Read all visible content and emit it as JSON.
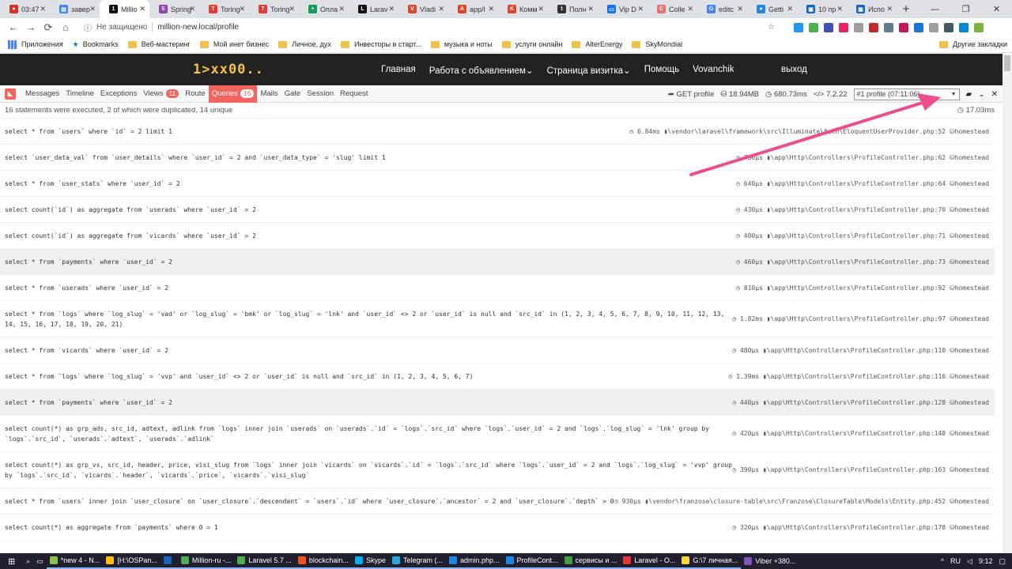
{
  "browser": {
    "tabs": [
      {
        "label": "03:47",
        "color": "#d93025",
        "glyph": "●"
      },
      {
        "label": "завер",
        "color": "#4285f4",
        "glyph": "▤"
      },
      {
        "label": "Millio",
        "color": "#111111",
        "glyph": "1",
        "active": true
      },
      {
        "label": "Spring",
        "color": "#8e44ad",
        "glyph": "S"
      },
      {
        "label": "Toring",
        "color": "#e53935",
        "glyph": "T"
      },
      {
        "label": "Toring",
        "color": "#e53935",
        "glyph": "T"
      },
      {
        "label": "Опла",
        "color": "#0f9d58",
        "glyph": "+"
      },
      {
        "label": "Larav",
        "color": "#111111",
        "glyph": "L"
      },
      {
        "label": "Vladi",
        "color": "#e2432a",
        "glyph": "V"
      },
      {
        "label": "app/l",
        "color": "#e2432a",
        "glyph": "A"
      },
      {
        "label": "Комм",
        "color": "#e2432a",
        "glyph": "K"
      },
      {
        "label": "Полн",
        "color": "#333333",
        "glyph": "t"
      },
      {
        "label": "Vip D",
        "color": "#1a73e8",
        "glyph": "▭"
      },
      {
        "label": "Colle",
        "color": "#e57373",
        "glyph": "C"
      },
      {
        "label": "editc",
        "color": "#4285f4",
        "glyph": "G"
      },
      {
        "label": "Getti",
        "color": "#1e88e5",
        "glyph": "●"
      },
      {
        "label": "10 пр",
        "color": "#1565c0",
        "glyph": "▣"
      },
      {
        "label": "Испо",
        "color": "#1565c0",
        "glyph": "▣"
      }
    ],
    "new_tab": "+",
    "window_controls": {
      "minimize": "—",
      "maximize": "❐",
      "close": "✕"
    },
    "nav": {
      "back": "←",
      "forward": "→",
      "reload": "⟳",
      "home": "⌂"
    },
    "address": {
      "info_icon": "ⓘ",
      "security": "Не защищено",
      "url": "million-new.local/profile",
      "star": "☆"
    },
    "extension_colors": [
      "#2196f3",
      "#4caf50",
      "#3f51b5",
      "#e91e63",
      "#9e9e9e",
      "#c62828",
      "#607d8b",
      "#c2185b",
      "#1976d2",
      "#9e9e9e",
      "#455a64",
      "#0288d1",
      "#7cb342"
    ],
    "bookmarks": {
      "apps": "Приложения",
      "items": [
        "Bookmarks",
        "Веб-мастеринг",
        "Мой инет бизнес",
        "Личное, дух",
        "Инвесторы в старт...",
        "музыка и ноты",
        "услуги онлайн",
        "AlterEnergy",
        "SkyMondial"
      ],
      "other": "Другие закладки"
    }
  },
  "site": {
    "logo": "1>xx00..",
    "nav": [
      "Главная",
      "Работа с объявлением⌄",
      "Страница визитка⌄",
      "Помощь",
      "Vovanchik"
    ],
    "logout": "выход"
  },
  "debugbar": {
    "tabs": [
      {
        "label": "Messages"
      },
      {
        "label": "Timeline"
      },
      {
        "label": "Exceptions"
      },
      {
        "label": "Views",
        "badge": "11"
      },
      {
        "label": "Route"
      },
      {
        "label": "Queries",
        "badge": "16",
        "active": true
      },
      {
        "label": "Mails"
      },
      {
        "label": "Gate"
      },
      {
        "label": "Session"
      },
      {
        "label": "Request"
      }
    ],
    "request": "GET profile",
    "memory": "18.94MB",
    "time": "680.73ms",
    "php": "7.2.22",
    "profile_select": "#1 profile (07:11:06)",
    "icons": {
      "request": "➦",
      "memory": "⛁",
      "time": "◷",
      "php": "</>",
      "folder": "📂",
      "collapse": "⌄",
      "close": "✕"
    }
  },
  "summary": {
    "text": "16 statements were executed, 2 of which were duplicated, 14 unique",
    "total_time": "17.03ms"
  },
  "queries": [
    {
      "sql": "select * from `users` where `id` = 2 limit 1",
      "duration": "6.84ms",
      "source": "\\vendor\\laravel\\framework\\src\\Illuminate\\Auth\\EloquentUserProvider.php:52",
      "connection": "homestead"
    },
    {
      "sql": "select `user_data_val` from `user_details` where `user_id` = 2 and `user_data_type` = 'slug' limit 1",
      "duration": "730μs",
      "source": "\\app\\Http\\Controllers\\ProfileController.php:62",
      "connection": "homestead"
    },
    {
      "sql": "select * from `user_stats` where `user_id` = 2",
      "duration": "640μs",
      "source": "\\app\\Http\\Controllers\\ProfileController.php:64",
      "connection": "homestead"
    },
    {
      "sql": "select count(`id`) as aggregate from `userads` where `user_id` = 2",
      "duration": "430μs",
      "source": "\\app\\Http\\Controllers\\ProfileController.php:70",
      "connection": "homestead"
    },
    {
      "sql": "select count(`id`) as aggregate from `vicards` where `user_id` = 2",
      "duration": "400μs",
      "source": "\\app\\Http\\Controllers\\ProfileController.php:71",
      "connection": "homestead"
    },
    {
      "sql": "select * from `payments` where `user_id` = 2",
      "duration": "460μs",
      "source": "\\app\\Http\\Controllers\\ProfileController.php:73",
      "connection": "homestead",
      "highlight": true
    },
    {
      "sql": "select * from `userads` where `user_id` = 2",
      "duration": "810μs",
      "source": "\\app\\Http\\Controllers\\ProfileController.php:92",
      "connection": "homestead"
    },
    {
      "sql": "select * from `logs` where `log_slug` = 'vad' or `log_slug` = 'bmk' or `log_slug` = 'lnk' and `user_id` <> 2 or `user_id` is null and `src_id` in (1, 2, 3, 4, 5, 6, 7, 8, 9, 10, 11, 12, 13,\n14, 15, 16, 17, 18, 19, 20, 21)",
      "duration": "1.82ms",
      "source": "\\app\\Http\\Controllers\\ProfileController.php:97",
      "connection": "homestead",
      "tall": true
    },
    {
      "sql": "select * from `vicards` where `user_id` = 2",
      "duration": "480μs",
      "source": "\\app\\Http\\Controllers\\ProfileController.php:110",
      "connection": "homestead"
    },
    {
      "sql": "select * from `logs` where `log_slug` = 'vvp' and `user_id` <> 2 or `user_id` is null and `src_id` in (1, 2, 3, 4, 5, 6, 7)",
      "duration": "1.39ms",
      "source": "\\app\\Http\\Controllers\\ProfileController.php:116",
      "connection": "homestead"
    },
    {
      "sql": "select * from `payments` where `user_id` = 2",
      "duration": "440μs",
      "source": "\\app\\Http\\Controllers\\ProfileController.php:128",
      "connection": "homestead",
      "highlight": true
    },
    {
      "sql": "select count(*) as grp_ads, src_id, adtext, adlink from `logs` inner join `userads` on `userads`.`id` = `logs`.`src_id` where `logs`.`user_id` = 2 and `logs`.`log_slug` = 'lnk' group by\n`logs`.`src_id`, `userads`.`adtext`, `userads`.`adlink`",
      "duration": "420μs",
      "source": "\\app\\Http\\Controllers\\ProfileController.php:148",
      "connection": "homestead",
      "tall": true
    },
    {
      "sql": "select count(*) as grp_vs, src_id, header, price, visi_slug from `logs` inner join `vicards` on `vicards`.`id` = `logs`.`src_id` where `logs`.`user_id` = 2 and `logs`.`log_slug` = 'vvp' group\nby `logs`.`src_id`, `vicards`.`header`, `vicards`.`price`, `vicards`.`visi_slug`",
      "duration": "390μs",
      "source": "\\app\\Http\\Controllers\\ProfileController.php:163",
      "connection": "homestead",
      "tall": true
    },
    {
      "sql": "select * from `users` inner join `user_closure` on `user_closure`.`descendant` = `users`.`id` where `user_closure`.`ancestor` = 2 and `user_closure`.`depth` > 0",
      "duration": "930μs",
      "source": "\\vendor\\franzose\\closure-table\\src\\Franzose\\ClosureTable\\Models\\Entity.php:452",
      "connection": "homestead"
    },
    {
      "sql": "select count(*) as aggregate from `payments` where 0 = 1",
      "duration": "320μs",
      "source": "\\app\\Http\\Controllers\\ProfileController.php:178",
      "connection": "homestead"
    }
  ],
  "meta_icons": {
    "clock": "◷",
    "source": "▮",
    "db": "⛁"
  },
  "taskbar": {
    "items": [
      {
        "label": "*new 4 - N...",
        "color": "#8bc34a"
      },
      {
        "label": "[H:\\OSPan...",
        "color": "#ffc107"
      },
      {
        "label": "",
        "color": "#1565c0"
      },
      {
        "label": "Million-ru -...",
        "color": "#4caf50"
      },
      {
        "label": "Laravel 5.7 ...",
        "color": "#4caf50"
      },
      {
        "label": "blockchain...",
        "color": "#f4511e"
      },
      {
        "label": "Skype",
        "color": "#00aff0"
      },
      {
        "label": "Telegram (...",
        "color": "#2ca5e0"
      },
      {
        "label": "admin.php...",
        "color": "#1e88e5"
      },
      {
        "label": "ProfileCont...",
        "color": "#1e88e5"
      },
      {
        "label": "сервисы и ...",
        "color": "#43a047"
      },
      {
        "label": "Laravel - O...",
        "color": "#e53935"
      },
      {
        "label": "G:\\7 личная...",
        "color": "#fdd835"
      },
      {
        "label": "Viber +380...",
        "color": "#7e57c2"
      }
    ],
    "lang": "RU",
    "clock": "9:12"
  }
}
